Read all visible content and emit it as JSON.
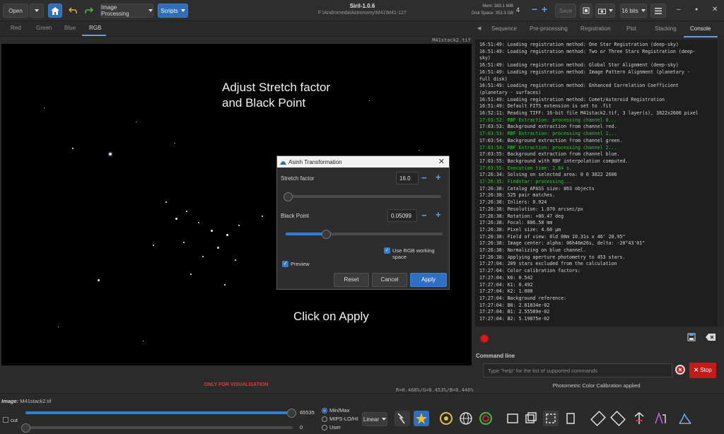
{
  "header": {
    "open_label": "Open",
    "image_processing_label": "Image Processing",
    "scripts_label": "Scripts",
    "app_title": "Siril-1.0.6",
    "path": "F:\\Andromeda\\Astronomy\\M41\\M41-127",
    "mem_label": "Mem: 383.1 MiB",
    "disk_label": "Disk Space: 353.3 GB",
    "threads_value": "4",
    "save_label": "Save",
    "bit_depth": "16 bits"
  },
  "channel_tabs": [
    "Red",
    "Green",
    "Blue",
    "RGB"
  ],
  "viewer": {
    "filename": "M41stack2.tif",
    "annotation_1_line1": "Adjust Stretch factor",
    "annotation_1_line2": "and Black Point",
    "annotation_2": "Click on Apply",
    "visualisation_note": "ONLY FOR VISUALISATION",
    "pixel_readout": "R=0.468%/G=0.453%/B=0.446%"
  },
  "dialog": {
    "title": "Asinh Transformation",
    "stretch_label": "Stretch factor",
    "stretch_value": "16.0",
    "stretch_fraction": 0.0,
    "black_point_label": "Black Point",
    "black_point_value": "0.05099",
    "black_point_fraction": 0.25,
    "use_rgb_label": "Use RGB working space",
    "preview_label": "Preview",
    "reset_label": "Reset",
    "cancel_label": "Cancel",
    "apply_label": "Apply"
  },
  "right_tabs": [
    "Sequence",
    "Pre-processing",
    "Registration",
    "Plot",
    "Stacking",
    "Console"
  ],
  "console_lines": [
    {
      "text": "16:51:49: Loading registration method: One Star Registration (deep-sky)",
      "color": "normal"
    },
    {
      "text": "16:51:49: Loading registration method: Two or Three Stars Registration (deep-",
      "color": "normal"
    },
    {
      "text": "sky)",
      "color": "normal"
    },
    {
      "text": "16:51:49: Loading registration method: Global Star Alignment (deep-sky)",
      "color": "normal"
    },
    {
      "text": "16:51:49: Loading registration method: Image Pattern Alignment (planetary -",
      "color": "normal"
    },
    {
      "text": "full disk)",
      "color": "normal"
    },
    {
      "text": "16:51:49: Loading registration method: Enhanced Correlation Coefficient",
      "color": "normal"
    },
    {
      "text": "(planetary - surfaces)",
      "color": "normal"
    },
    {
      "text": "16:51:49: Loading registration method: Comet/Asteroid Registration",
      "color": "normal"
    },
    {
      "text": "16:51:49: Default FITS extension is set to .fit",
      "color": "normal"
    },
    {
      "text": "16:52:11: Reading TIFF: 16-bit file M41stack2.tif, 3 layer(s), 3822x2606 pixel",
      "color": "normal"
    },
    {
      "text": "17:03:52: RBF Extraction: processing channel 0...",
      "color": "green"
    },
    {
      "text": "17:03:53: Background extraction from channel red.",
      "color": "normal"
    },
    {
      "text": "17:03:53: RBF Extraction: processing channel 1...",
      "color": "green"
    },
    {
      "text": "17:03:54: Background extraction from channel green.",
      "color": "normal"
    },
    {
      "text": "17:03:54: RBF Extraction: processing channel 2...",
      "color": "green"
    },
    {
      "text": "17:03:55: Background extraction from channel blue.",
      "color": "normal"
    },
    {
      "text": "17:03:55: Background with RBF interpolation computed.",
      "color": "normal"
    },
    {
      "text": "17:03:55: Execution time: 2.84 s.",
      "color": "green"
    },
    {
      "text": "17:26:34: Solving on selected area: 0 0 3822 2606",
      "color": "normal"
    },
    {
      "text": "17:26:35: Findstar: processing...",
      "color": "green"
    },
    {
      "text": "17:26:38: Catalog APASS size: 863 objects",
      "color": "normal"
    },
    {
      "text": "17:26:38: 525 pair matches.",
      "color": "normal"
    },
    {
      "text": "17:26:38: Inliers:          0.924",
      "color": "normal"
    },
    {
      "text": "17:26:38: Resolution:       1.070 arcsec/px",
      "color": "normal"
    },
    {
      "text": "17:26:38: Rotation:        +86.47 deg",
      "color": "normal"
    },
    {
      "text": "17:26:38: Focal:           886.58 mm",
      "color": "normal"
    },
    {
      "text": "17:26:38: Pixel size:        4.60 µm",
      "color": "normal"
    },
    {
      "text": "17:26:38: Field of view:    0ld 08m 10.31s x 46' 28.95\"",
      "color": "normal"
    },
    {
      "text": "17:26:38: Image center: alpha:  06h46m26s, delta: -20°43'01\"",
      "color": "normal"
    },
    {
      "text": "17:26:38: Normalizing on blue channel.",
      "color": "normal"
    },
    {
      "text": "17:26:38: Applying aperture photometry to 453 stars.",
      "color": "normal"
    },
    {
      "text": "17:27:04: 209 stars excluded from the calculation",
      "color": "normal"
    },
    {
      "text": "17:27:04: Color calibration factors:",
      "color": "normal"
    },
    {
      "text": "17:27:04: K0: 0.542",
      "color": "normal"
    },
    {
      "text": "17:27:04: K1: 0.492",
      "color": "normal"
    },
    {
      "text": "17:27:04: K2: 1.000",
      "color": "normal"
    },
    {
      "text": "17:27:04: Background reference:",
      "color": "normal"
    },
    {
      "text": "17:27:04: B0: 2.81834e-02",
      "color": "normal"
    },
    {
      "text": "17:27:04: B1: 2.55589e-02",
      "color": "normal"
    },
    {
      "text": "17:27:04: B2: 5.19875e-02",
      "color": "normal"
    }
  ],
  "command_line": {
    "label": "Command line",
    "placeholder": "Type \"help\" for the list of supported commands",
    "stop_label": "Stop",
    "status": "Photometric Color Calibration applied"
  },
  "bottom": {
    "image_label": "Image:",
    "image_name": "M41stack2.tif",
    "cut_label": "cut",
    "hi_value": "65535",
    "lo_value": "0",
    "hi_fraction": 1.0,
    "lo_fraction": 0.0,
    "radio_minmax": "Min/Max",
    "radio_mips": "MIPS-LO/HI",
    "radio_user": "User",
    "scale_mode": "Linear"
  },
  "colors": {
    "accent": "#2f7ed8",
    "stop_red": "#c61a1a",
    "console_green": "#35c135",
    "warning_red": "#e23a3a"
  }
}
